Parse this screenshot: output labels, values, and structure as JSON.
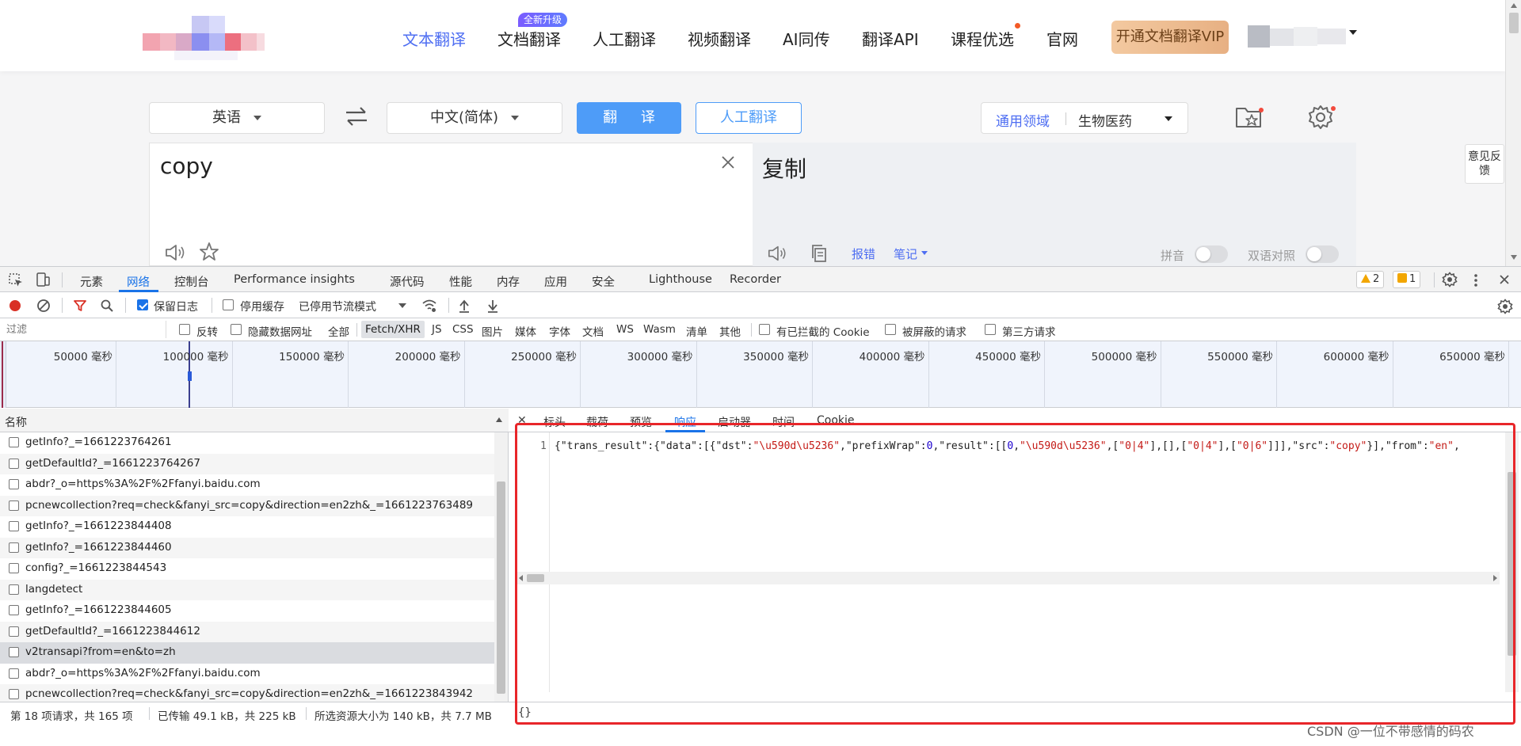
{
  "nav": {
    "items": [
      "文本翻译",
      "文档翻译",
      "人工翻译",
      "视频翻译",
      "AI同传",
      "翻译API",
      "课程优选",
      "官网"
    ],
    "badge": "全新升级",
    "vip": "开通文档翻译VIP"
  },
  "translator": {
    "source_lang": "英语",
    "target_lang": "中文(简体)",
    "translate_btn": "翻 译",
    "human_btn": "人工翻译",
    "domain_label": "通用领域",
    "domain_value": "生物医药",
    "source_text": "copy",
    "result_text": "复制",
    "report": "报错",
    "notes": "笔记",
    "pinyin": "拼音",
    "bilingual": "双语对照",
    "feedback": "意见反馈"
  },
  "devtools": {
    "tabs": [
      "元素",
      "网络",
      "控制台",
      "Performance insights",
      "源代码",
      "性能",
      "内存",
      "应用",
      "安全",
      "Lighthouse",
      "Recorder"
    ],
    "warnings": "2",
    "issues": "1",
    "toolbar": {
      "preserve_log": "保留日志",
      "disable_cache": "停用缓存",
      "throttle": "已停用节流模式"
    },
    "filter": {
      "placeholder": "过滤",
      "invert": "反转",
      "hide_data_urls": "隐藏数据网址",
      "types": [
        "全部",
        "Fetch/XHR",
        "JS",
        "CSS",
        "图片",
        "媒体",
        "字体",
        "文档",
        "WS",
        "Wasm",
        "清单",
        "其他"
      ],
      "blocked_cookies": "有已拦截的 Cookie",
      "blocked_requests": "被屏蔽的请求",
      "third_party": "第三方请求"
    },
    "timeline_ticks": [
      "50000 毫秒",
      "100000 毫秒",
      "150000 毫秒",
      "200000 毫秒",
      "250000 毫秒",
      "300000 毫秒",
      "350000 毫秒",
      "400000 毫秒",
      "450000 毫秒",
      "500000 毫秒",
      "550000 毫秒",
      "600000 毫秒",
      "650000 毫秒"
    ],
    "list_header": "名称",
    "requests": [
      "getInfo?_=1661223764261",
      "getDefaultId?_=1661223764267",
      "abdr?_o=https%3A%2F%2Ffanyi.baidu.com",
      "pcnewcollection?req=check&fanyi_src=copy&direction=en2zh&_=1661223763489",
      "getInfo?_=1661223844408",
      "getInfo?_=1661223844460",
      "config?_=1661223844543",
      "langdetect",
      "getInfo?_=1661223844605",
      "getDefaultId?_=1661223844612",
      "v2transapi?from=en&to=zh",
      "abdr?_o=https%3A%2F%2Ffanyi.baidu.com",
      "pcnewcollection?req=check&fanyi_src=copy&direction=en2zh&_=1661223843942"
    ],
    "detail_tabs": [
      "标头",
      "载荷",
      "预览",
      "响应",
      "启动器",
      "时间",
      "Cookie"
    ],
    "response_line_no": "1",
    "response_parts": [
      {
        "t": "p",
        "v": "{\"trans_result\":{\"data\":[{\"dst\":"
      },
      {
        "t": "s",
        "v": "\"\\u590d\\u5236\""
      },
      {
        "t": "p",
        "v": ",\"prefixWrap\":"
      },
      {
        "t": "n",
        "v": "0"
      },
      {
        "t": "p",
        "v": ",\"result\":[["
      },
      {
        "t": "n",
        "v": "0"
      },
      {
        "t": "p",
        "v": ","
      },
      {
        "t": "s",
        "v": "\"\\u590d\\u5236\""
      },
      {
        "t": "p",
        "v": ",["
      },
      {
        "t": "s",
        "v": "\"0|4\""
      },
      {
        "t": "p",
        "v": "],[],["
      },
      {
        "t": "s",
        "v": "\"0|4\""
      },
      {
        "t": "p",
        "v": "],["
      },
      {
        "t": "s",
        "v": "\"0|6\""
      },
      {
        "t": "p",
        "v": "]]],\"src\":"
      },
      {
        "t": "s",
        "v": "\"copy\""
      },
      {
        "t": "p",
        "v": "}],\"from\":"
      },
      {
        "t": "s",
        "v": "\"en\""
      },
      {
        "t": "p",
        "v": ","
      }
    ],
    "status": {
      "requests": "第 18 项请求，共 165 项",
      "transferred": "已传输 49.1 kB，共 225 kB",
      "resources": "所选资源大小为 140 kB，共 7.7 MB",
      "pretty_print": "{}"
    }
  },
  "watermark": "CSDN @一位不带感情的码农",
  "colors": {
    "accent": "#4e9cf8",
    "devtools_blue": "#1a73e8",
    "highlight": "#e8262a"
  }
}
